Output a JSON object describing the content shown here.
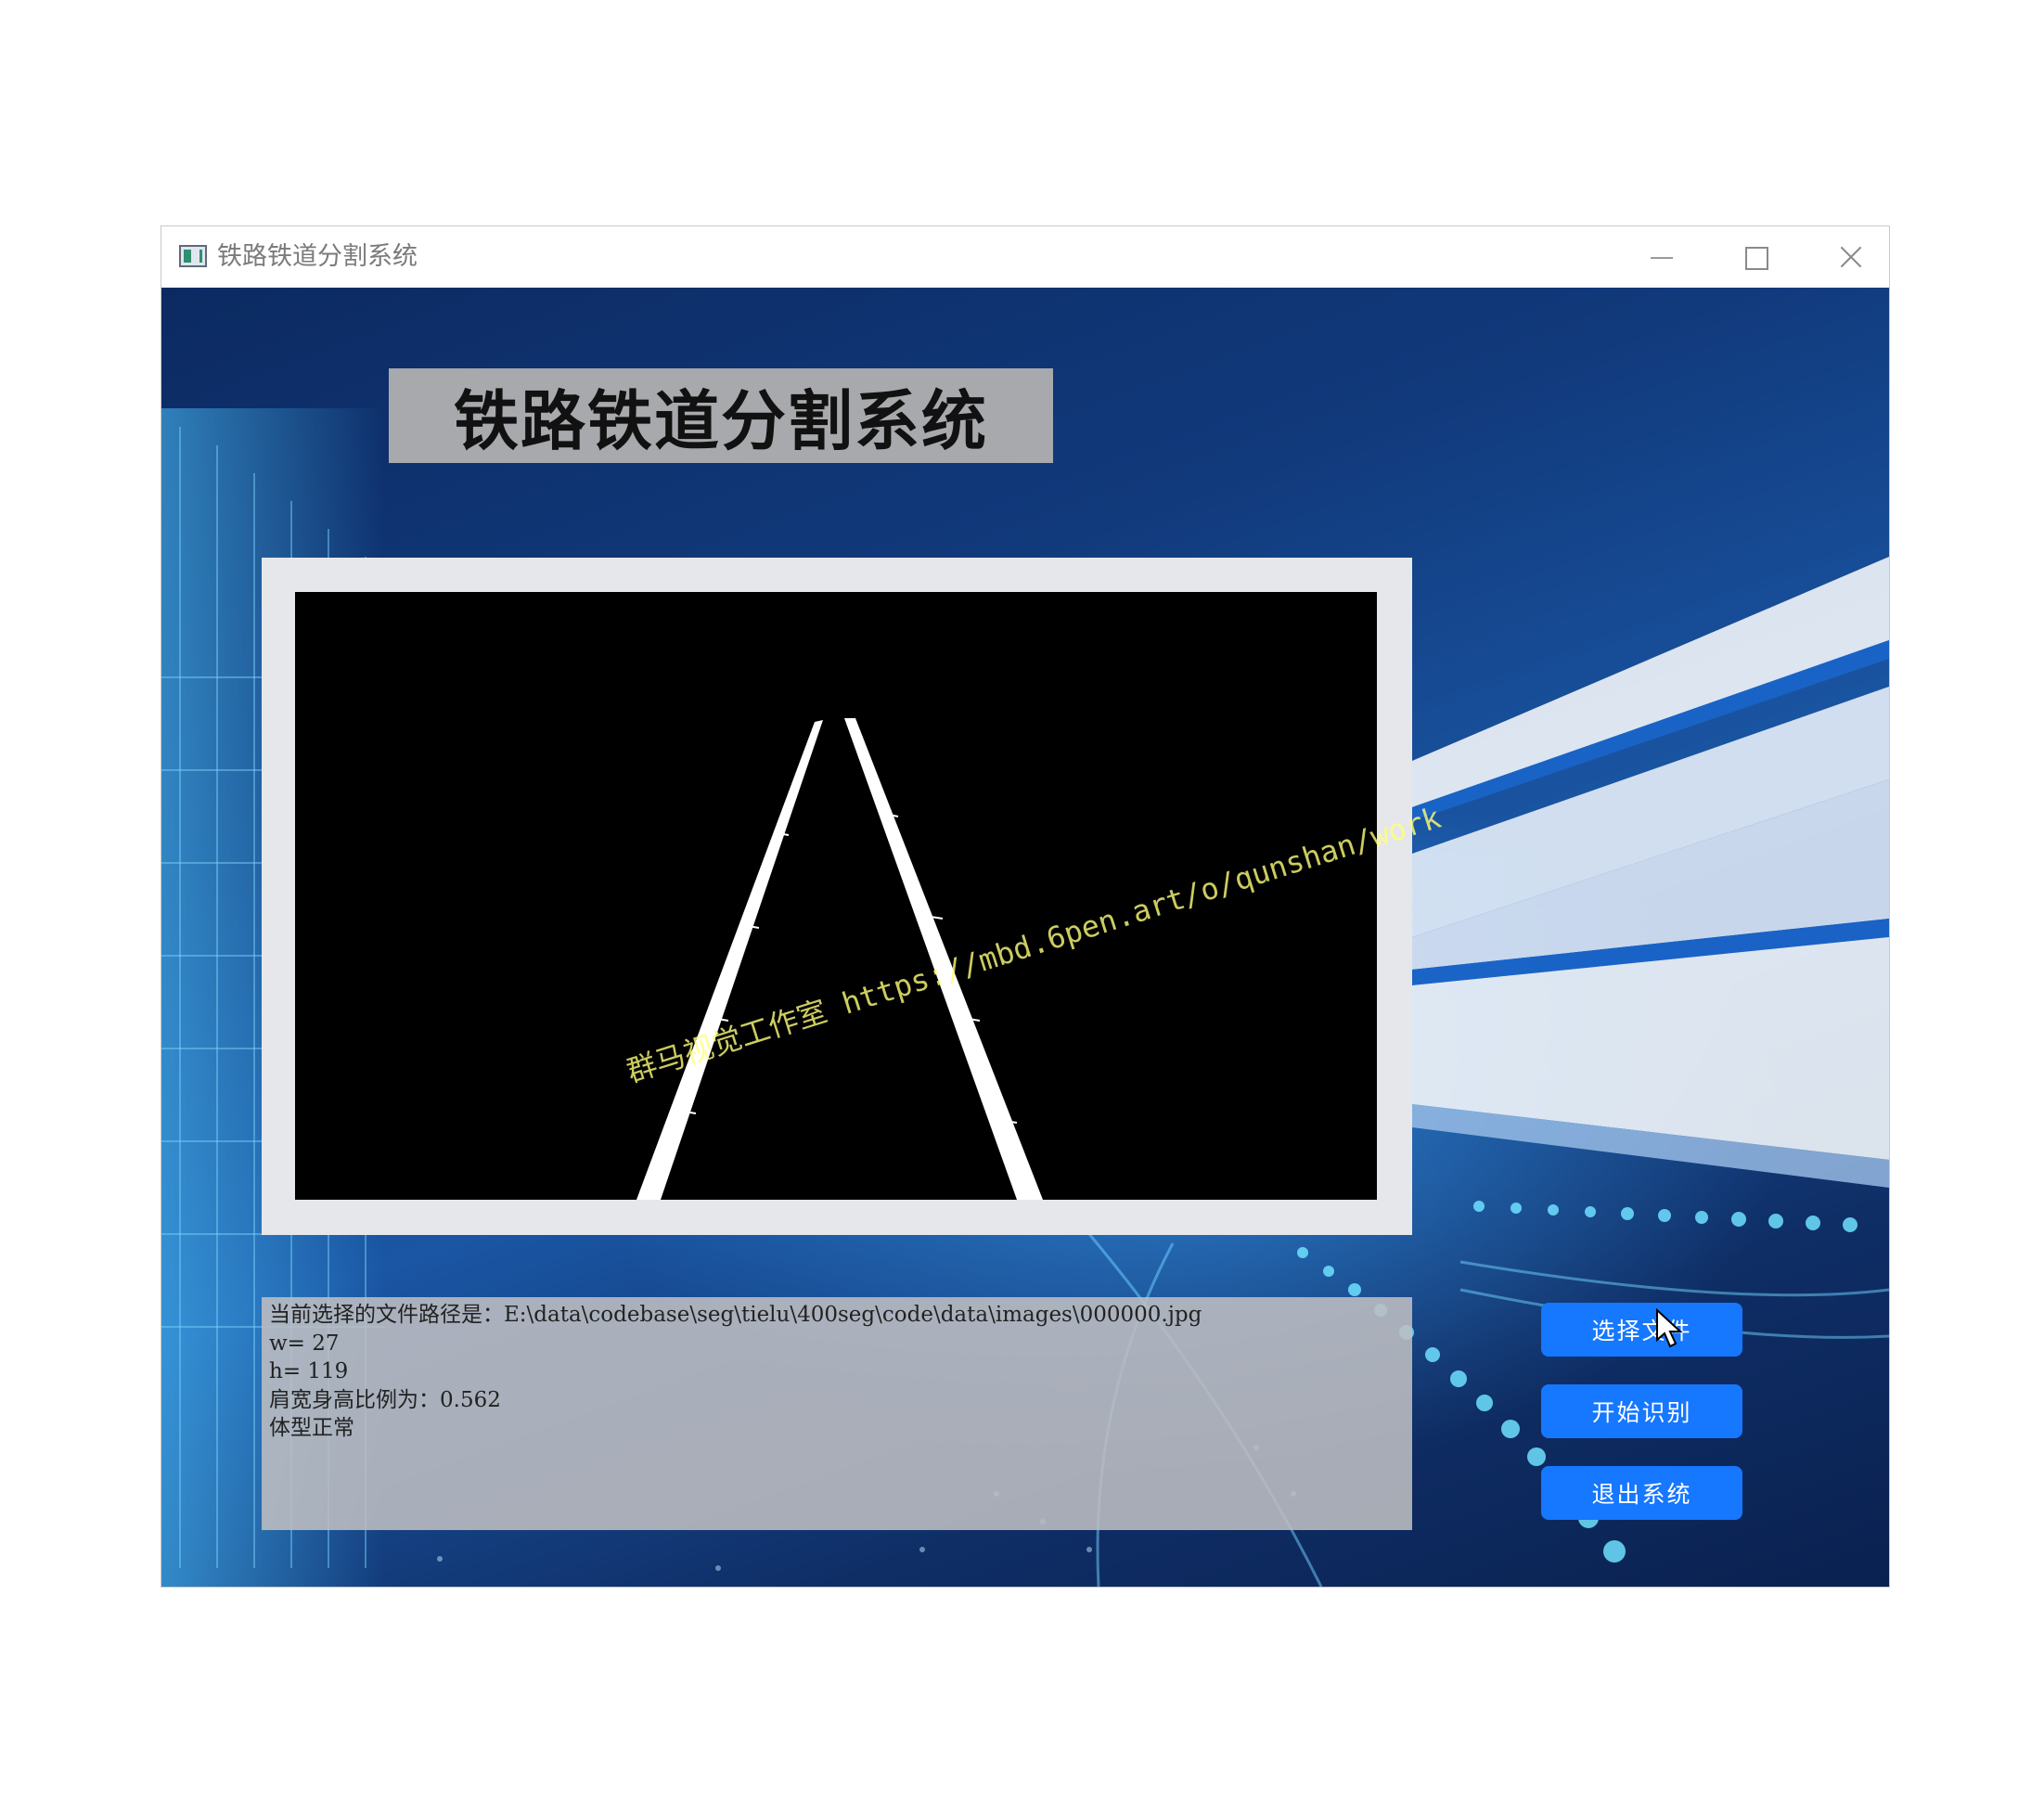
{
  "window": {
    "title": "铁路铁道分割系统",
    "app_icon": "app-window-icon",
    "controls": [
      "minimize-icon",
      "maximize-icon",
      "close-icon"
    ]
  },
  "main": {
    "heading": "铁路铁道分割系统",
    "watermark": "群马视觉工作室 https://mbd.6pen.art/o/qunshan/work",
    "output_lines": [
      "当前选择的文件路径是：E:\\data\\codebase\\seg\\tielu\\400seg\\code\\data\\images\\000000.jpg",
      "w= 27",
      "h= 119",
      "肩宽身高比例为：0.562",
      "体型正常"
    ]
  },
  "buttons": {
    "select_file": "选择文件",
    "start_recognition": "开始识别",
    "exit_system": "退出系统"
  },
  "colors": {
    "button_bg": "#1677ff",
    "heading_box": "#a7a9ad",
    "image_frame": "#e6e7ea",
    "watermark": "#ffff7a",
    "background": "#113a7c"
  }
}
